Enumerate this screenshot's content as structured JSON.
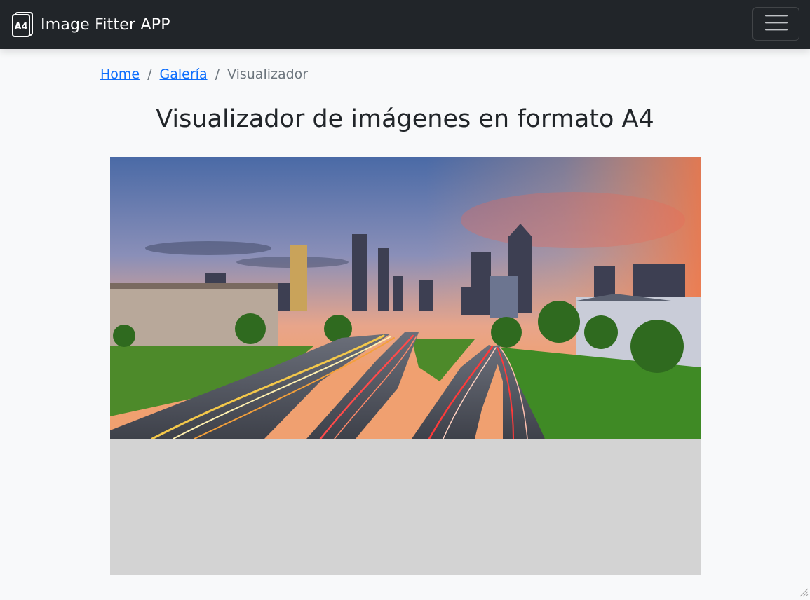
{
  "navbar": {
    "brand_logo_text": "A4",
    "brand_text": "Image Fitter APP",
    "toggler_icon": "hamburger-menu-icon",
    "background": "#212529"
  },
  "breadcrumb": {
    "items": [
      {
        "label": "Home"
      },
      {
        "label": "Galería"
      },
      {
        "label": "Visualizador"
      }
    ],
    "separator": "/"
  },
  "main": {
    "title": "Visualizador de imágenes en formato A4",
    "viewer": {
      "image_subject": "city-skyline-highway-photo",
      "page_background": "#d3d3d3"
    }
  },
  "colors": {
    "link": "#0d6efd",
    "muted": "#6c757d",
    "text": "#212529",
    "page_bg": "#f8f9fa"
  }
}
